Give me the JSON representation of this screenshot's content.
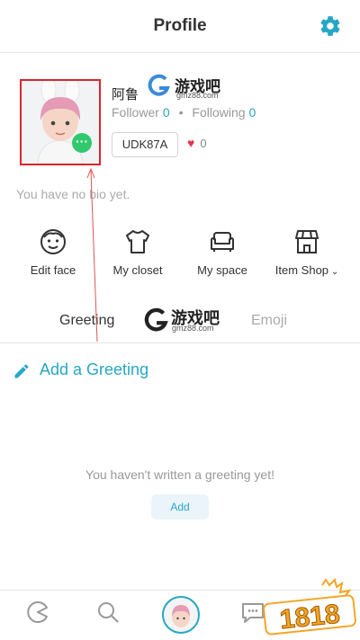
{
  "header": {
    "title": "Profile"
  },
  "profile": {
    "username": "阿鲁",
    "follower_label": "Follower",
    "follower_count": "0",
    "following_label": "Following",
    "following_count": "0",
    "code": "UDK87A",
    "likes": "0",
    "bio": "You have no bio yet."
  },
  "menu": {
    "items": [
      {
        "label": "Edit face"
      },
      {
        "label": "My closet"
      },
      {
        "label": "My space"
      },
      {
        "label": "Item Shop"
      }
    ]
  },
  "tabs": {
    "greeting": "Greeting",
    "emoji": "Emoji"
  },
  "greeting_section": {
    "title": "Add a Greeting",
    "empty_message": "You haven't written a greeting yet!",
    "add_label": "Add"
  },
  "watermarks": {
    "site_name": "游戏吧",
    "site_url": "gmz88.com",
    "brand": "1818"
  },
  "colors": {
    "accent": "#27a7c4",
    "highlight": "#d9262c",
    "green": "#32c96e"
  }
}
